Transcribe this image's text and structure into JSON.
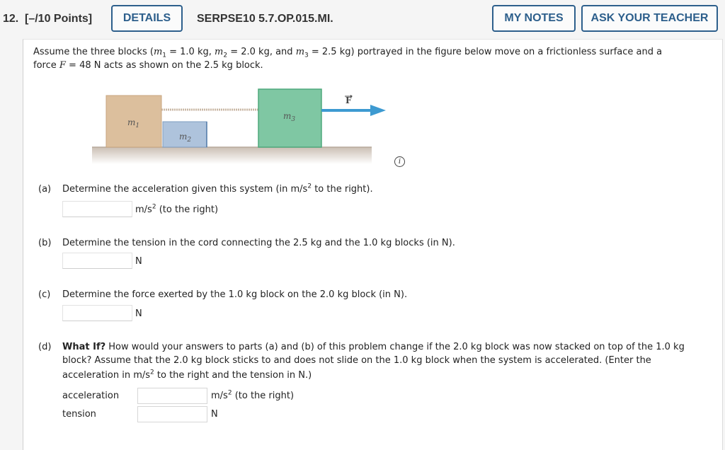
{
  "header": {
    "question_number": "12.",
    "points": "[–/10 Points]",
    "details_button": "DETAILS",
    "problem_code": "SERPSE10 5.7.OP.015.MI.",
    "my_notes_button": "MY NOTES",
    "ask_teacher_button": "ASK YOUR TEACHER"
  },
  "intro": {
    "t1": "Assume the three blocks (",
    "m1": "m",
    "m1_sub": "1",
    "t2": " = 1.0 kg, ",
    "m2": "m",
    "m2_sub": "2",
    "t3": " = 2.0 kg, and ",
    "m3": "m",
    "m3_sub": "3",
    "t4": " = 2.5 kg) portrayed in the figure below move on a frictionless surface and a",
    "t5": "force ",
    "F": "F",
    "t6": " = 48 N acts as shown on the 2.5 kg block."
  },
  "figure": {
    "block1_label": "m",
    "block1_sub": "1",
    "block2_label": "m",
    "block2_sub": "2",
    "block3_label": "m",
    "block3_sub": "3",
    "force_label": "F",
    "colors": {
      "block1": "#dcbf9d",
      "block2": "#aec3dc",
      "block3": "#7fc7a3",
      "ground": "#d8d0c8",
      "arrow": "#3d9ad1",
      "rope": "#c9b7a4"
    },
    "info_icon": "i"
  },
  "parts": {
    "a": {
      "label": "(a)",
      "question_pre": "Determine the acceleration given this system (in m/s",
      "question_sup": "2",
      "question_post": " to the right).",
      "input_value": "",
      "unit_pre": "m/s",
      "unit_sup": "2",
      "unit_post": " (to the right)"
    },
    "b": {
      "label": "(b)",
      "question": "Determine the tension in the cord connecting the 2.5 kg and the 1.0 kg blocks (in N).",
      "input_value": "",
      "unit": "N"
    },
    "c": {
      "label": "(c)",
      "question": "Determine the force exerted by the 1.0 kg block on the 2.0 kg block (in N).",
      "input_value": "",
      "unit": "N"
    },
    "d": {
      "label": "(d)",
      "bold": "What If?",
      "line1": " How would your answers to parts (a) and (b) of this problem change if the 2.0 kg block was now stacked on top of the 1.0 kg",
      "line2": "block? Assume that the 2.0 kg block sticks to and does not slide on the 1.0 kg block when the system is accelerated. (Enter the",
      "line3_pre": "acceleration in m/s",
      "line3_sup": "2",
      "line3_post": " to the right and the tension in N.)",
      "acceleration_label": "acceleration",
      "acceleration_value": "",
      "acceleration_unit_pre": "m/s",
      "acceleration_unit_sup": "2",
      "acceleration_unit_post": " (to the right)",
      "tension_label": "tension",
      "tension_value": "",
      "tension_unit": "N"
    }
  }
}
